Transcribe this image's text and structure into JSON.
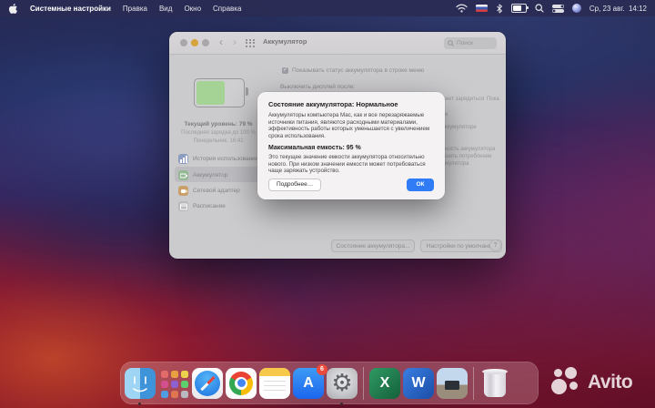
{
  "menu_bar": {
    "app_name": "Системные настройки",
    "menus": [
      "Правка",
      "Вид",
      "Окно",
      "Справка"
    ],
    "status_icons": [
      "wifi-icon",
      "ru-flag-icon",
      "bluetooth-icon",
      "battery-icon",
      "spotlight-icon",
      "control-center-icon",
      "siri-icon"
    ],
    "clock": "Ср, 23 авг.  14:12"
  },
  "window": {
    "title": "Аккумулятор",
    "search_placeholder": "Поиск",
    "toolbar": {
      "back": "‹",
      "forward": "›"
    },
    "sidebar": [
      {
        "label": "История использования",
        "icon": "usage-history-icon"
      },
      {
        "label": "Аккумулятор",
        "icon": "battery-icon"
      },
      {
        "label": "Сетевой адаптер",
        "icon": "power-adapter-icon"
      },
      {
        "label": "Расписание",
        "icon": "schedule-icon"
      }
    ],
    "content": {
      "menu_status_checkbox": "Показывать статус аккумулятора в строке меню",
      "turn_off_display_label": "Выключить дисплей после:",
      "current_level": "Текущий уровень: 79 %",
      "last_charge": "Последняя зарядка до 100 %",
      "last_charge_time": "Понедельник, 16:41",
      "occluded": {
        "l1": "жет зарядиться",
        "l1b": "Пока",
        "l2": "е",
        "l3": "ккумуляторе",
        "l4": "ность аккумулятора",
        "l5": "шить потребление",
        "l6": "мулятора"
      }
    },
    "footer": {
      "battery_state_button": "Состояние аккумулятора...",
      "defaults_button": "Настройки по умолчанию",
      "help_button": "?"
    }
  },
  "dialog": {
    "title": "Состояние аккумулятора: Нормальное",
    "paragraph1": "Аккумуляторы компьютера Mac, как и все перезаряжаемые источники питания, являются расходными материалами, эффективность работы которых уменьшается с увеличением срока использования.",
    "capacity_title": "Максимальная емкость: 95 %",
    "paragraph2": "Это текущее значение емкости аккумулятора относительно нового. При низком значении емкости может потребоваться чаще заряжать устройство.",
    "more_button": "Подробнее…",
    "ok_button": "ОК"
  },
  "dock": {
    "badge": "6",
    "apps": [
      {
        "icon": "finder-icon"
      },
      {
        "icon": "launchpad-icon"
      },
      {
        "icon": "safari-icon"
      },
      {
        "icon": "chrome-icon"
      },
      {
        "icon": "notes-icon"
      },
      {
        "icon": "app-store-icon",
        "glyph": "A"
      },
      {
        "icon": "system-preferences-icon",
        "glyph": "⚙"
      },
      {
        "icon": "excel-icon",
        "glyph": "X"
      },
      {
        "icon": "word-icon",
        "glyph": "W"
      },
      {
        "icon": "image-file-icon"
      },
      {
        "icon": "trash-icon"
      }
    ]
  },
  "watermark": {
    "brand": "Avito"
  },
  "colors": {
    "accent_blue": "#2f7cf6",
    "badge_red": "#ec4b3c",
    "battery_green": "#a5d295"
  }
}
